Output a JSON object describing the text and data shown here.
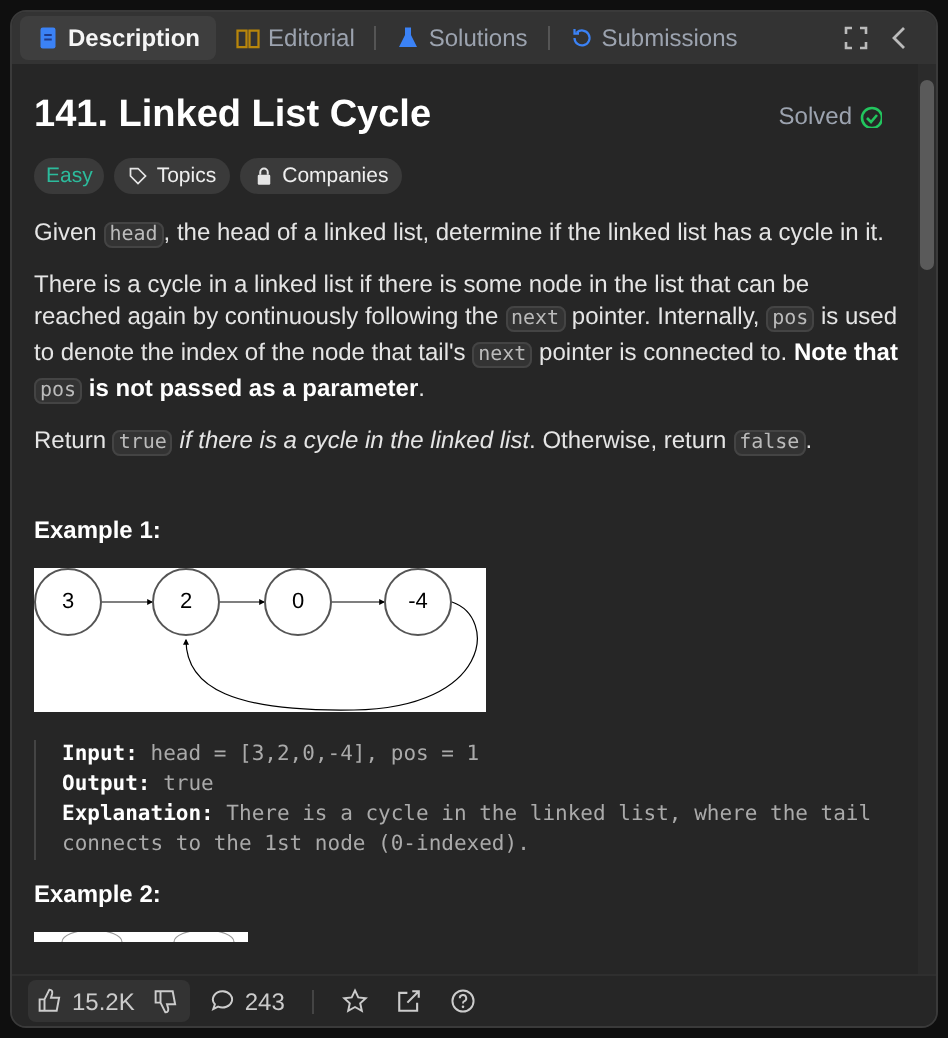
{
  "tabs": [
    {
      "label": "Description",
      "selected": true
    },
    {
      "label": "Editorial",
      "selected": false
    },
    {
      "label": "Solutions",
      "selected": false
    },
    {
      "label": "Submissions",
      "selected": false
    }
  ],
  "problem": {
    "title": "141. Linked List Cycle",
    "status": "Solved",
    "difficulty": "Easy",
    "tags": [
      {
        "label": "Topics"
      },
      {
        "label": "Companies"
      }
    ]
  },
  "paragraphs": [
    [
      {
        "kind": "text",
        "text": "Given "
      },
      {
        "kind": "code",
        "text": "head"
      },
      {
        "kind": "text",
        "text": ", the head of a linked list, determine if the linked list has a cycle in it."
      }
    ],
    [
      {
        "kind": "text",
        "text": "There is a cycle in a linked list if there is some node in the list that can be reached again by continuously following the "
      },
      {
        "kind": "code",
        "text": "next"
      },
      {
        "kind": "text",
        "text": " pointer. Internally, "
      },
      {
        "kind": "code",
        "text": "pos"
      },
      {
        "kind": "text",
        "text": " is used to denote the index of the node that tail's "
      },
      {
        "kind": "code",
        "text": "next"
      },
      {
        "kind": "text",
        "text": " pointer is connected to. "
      },
      {
        "kind": "bold",
        "text": "Note that "
      },
      {
        "kind": "code",
        "text": "pos"
      },
      {
        "kind": "bold",
        "text": " is not passed as a parameter"
      },
      {
        "kind": "text",
        "text": "."
      }
    ],
    [
      {
        "kind": "text",
        "text": "Return "
      },
      {
        "kind": "code",
        "text": "true"
      },
      {
        "kind": "italic",
        "text": " if there is a cycle in the linked list"
      },
      {
        "kind": "text",
        "text": ". Otherwise, return "
      },
      {
        "kind": "code",
        "text": "false"
      },
      {
        "kind": "text",
        "text": "."
      }
    ]
  ],
  "examples": [
    {
      "heading": "Example 1:",
      "nodes": [
        "3",
        "2",
        "0",
        "-4"
      ],
      "lines": [
        {
          "label": "Input:",
          "text": "head = [3,2,0,-4], pos = 1"
        },
        {
          "label": "Output:",
          "text": "true"
        },
        {
          "label": "Explanation:",
          "text": "There is a cycle in the linked list, where the tail connects to the 1st node (0-indexed)."
        }
      ]
    },
    {
      "heading": "Example 2:"
    }
  ],
  "footer": {
    "likes": "15.2K",
    "comments": "243"
  }
}
